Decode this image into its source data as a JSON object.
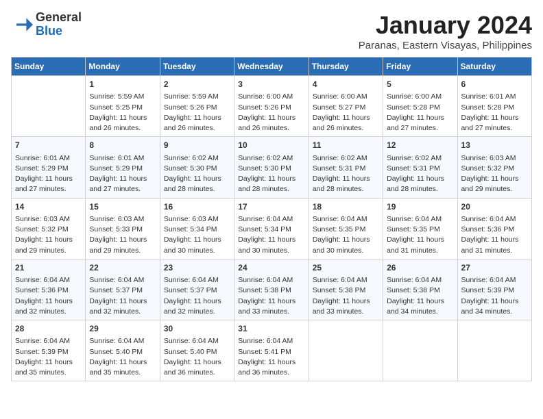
{
  "header": {
    "logo_general": "General",
    "logo_blue": "Blue",
    "month_title": "January 2024",
    "subtitle": "Paranas, Eastern Visayas, Philippines"
  },
  "days_of_week": [
    "Sunday",
    "Monday",
    "Tuesday",
    "Wednesday",
    "Thursday",
    "Friday",
    "Saturday"
  ],
  "weeks": [
    [
      {
        "day": "",
        "info": ""
      },
      {
        "day": "1",
        "info": "Sunrise: 5:59 AM\nSunset: 5:25 PM\nDaylight: 11 hours\nand 26 minutes."
      },
      {
        "day": "2",
        "info": "Sunrise: 5:59 AM\nSunset: 5:26 PM\nDaylight: 11 hours\nand 26 minutes."
      },
      {
        "day": "3",
        "info": "Sunrise: 6:00 AM\nSunset: 5:26 PM\nDaylight: 11 hours\nand 26 minutes."
      },
      {
        "day": "4",
        "info": "Sunrise: 6:00 AM\nSunset: 5:27 PM\nDaylight: 11 hours\nand 26 minutes."
      },
      {
        "day": "5",
        "info": "Sunrise: 6:00 AM\nSunset: 5:28 PM\nDaylight: 11 hours\nand 27 minutes."
      },
      {
        "day": "6",
        "info": "Sunrise: 6:01 AM\nSunset: 5:28 PM\nDaylight: 11 hours\nand 27 minutes."
      }
    ],
    [
      {
        "day": "7",
        "info": "Sunrise: 6:01 AM\nSunset: 5:29 PM\nDaylight: 11 hours\nand 27 minutes."
      },
      {
        "day": "8",
        "info": "Sunrise: 6:01 AM\nSunset: 5:29 PM\nDaylight: 11 hours\nand 27 minutes."
      },
      {
        "day": "9",
        "info": "Sunrise: 6:02 AM\nSunset: 5:30 PM\nDaylight: 11 hours\nand 28 minutes."
      },
      {
        "day": "10",
        "info": "Sunrise: 6:02 AM\nSunset: 5:30 PM\nDaylight: 11 hours\nand 28 minutes."
      },
      {
        "day": "11",
        "info": "Sunrise: 6:02 AM\nSunset: 5:31 PM\nDaylight: 11 hours\nand 28 minutes."
      },
      {
        "day": "12",
        "info": "Sunrise: 6:02 AM\nSunset: 5:31 PM\nDaylight: 11 hours\nand 28 minutes."
      },
      {
        "day": "13",
        "info": "Sunrise: 6:03 AM\nSunset: 5:32 PM\nDaylight: 11 hours\nand 29 minutes."
      }
    ],
    [
      {
        "day": "14",
        "info": "Sunrise: 6:03 AM\nSunset: 5:32 PM\nDaylight: 11 hours\nand 29 minutes."
      },
      {
        "day": "15",
        "info": "Sunrise: 6:03 AM\nSunset: 5:33 PM\nDaylight: 11 hours\nand 29 minutes."
      },
      {
        "day": "16",
        "info": "Sunrise: 6:03 AM\nSunset: 5:34 PM\nDaylight: 11 hours\nand 30 minutes."
      },
      {
        "day": "17",
        "info": "Sunrise: 6:04 AM\nSunset: 5:34 PM\nDaylight: 11 hours\nand 30 minutes."
      },
      {
        "day": "18",
        "info": "Sunrise: 6:04 AM\nSunset: 5:35 PM\nDaylight: 11 hours\nand 30 minutes."
      },
      {
        "day": "19",
        "info": "Sunrise: 6:04 AM\nSunset: 5:35 PM\nDaylight: 11 hours\nand 31 minutes."
      },
      {
        "day": "20",
        "info": "Sunrise: 6:04 AM\nSunset: 5:36 PM\nDaylight: 11 hours\nand 31 minutes."
      }
    ],
    [
      {
        "day": "21",
        "info": "Sunrise: 6:04 AM\nSunset: 5:36 PM\nDaylight: 11 hours\nand 32 minutes."
      },
      {
        "day": "22",
        "info": "Sunrise: 6:04 AM\nSunset: 5:37 PM\nDaylight: 11 hours\nand 32 minutes."
      },
      {
        "day": "23",
        "info": "Sunrise: 6:04 AM\nSunset: 5:37 PM\nDaylight: 11 hours\nand 32 minutes."
      },
      {
        "day": "24",
        "info": "Sunrise: 6:04 AM\nSunset: 5:38 PM\nDaylight: 11 hours\nand 33 minutes."
      },
      {
        "day": "25",
        "info": "Sunrise: 6:04 AM\nSunset: 5:38 PM\nDaylight: 11 hours\nand 33 minutes."
      },
      {
        "day": "26",
        "info": "Sunrise: 6:04 AM\nSunset: 5:38 PM\nDaylight: 11 hours\nand 34 minutes."
      },
      {
        "day": "27",
        "info": "Sunrise: 6:04 AM\nSunset: 5:39 PM\nDaylight: 11 hours\nand 34 minutes."
      }
    ],
    [
      {
        "day": "28",
        "info": "Sunrise: 6:04 AM\nSunset: 5:39 PM\nDaylight: 11 hours\nand 35 minutes."
      },
      {
        "day": "29",
        "info": "Sunrise: 6:04 AM\nSunset: 5:40 PM\nDaylight: 11 hours\nand 35 minutes."
      },
      {
        "day": "30",
        "info": "Sunrise: 6:04 AM\nSunset: 5:40 PM\nDaylight: 11 hours\nand 36 minutes."
      },
      {
        "day": "31",
        "info": "Sunrise: 6:04 AM\nSunset: 5:41 PM\nDaylight: 11 hours\nand 36 minutes."
      },
      {
        "day": "",
        "info": ""
      },
      {
        "day": "",
        "info": ""
      },
      {
        "day": "",
        "info": ""
      }
    ]
  ]
}
